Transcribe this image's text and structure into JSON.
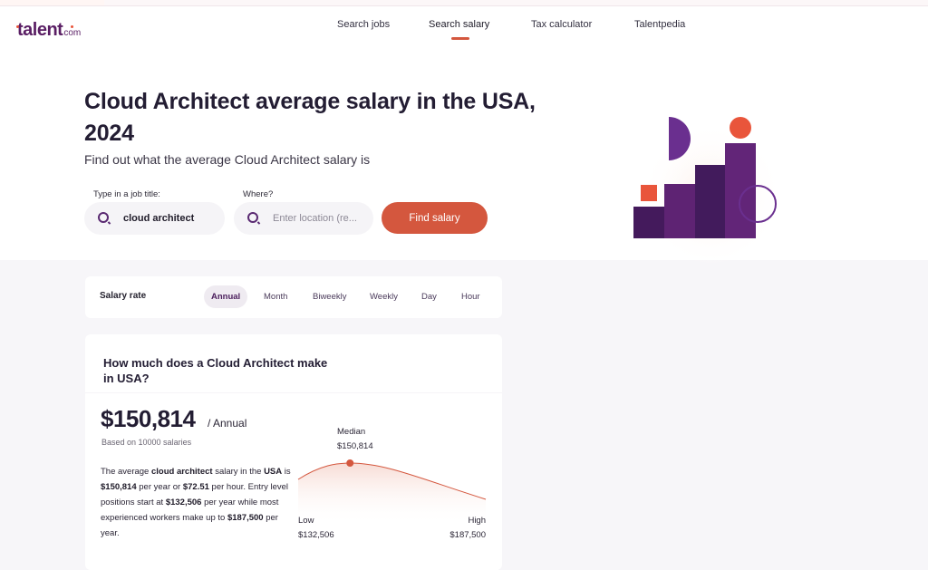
{
  "brand": {
    "name": "talent",
    "suffix": "com",
    "accent_color": "#d4573e",
    "primary_color": "#5a1e64"
  },
  "nav": {
    "items": [
      {
        "label": "Search jobs",
        "active": false
      },
      {
        "label": "Search salary",
        "active": true
      },
      {
        "label": "Tax calculator",
        "active": false
      },
      {
        "label": "Talentpedia",
        "active": false
      }
    ]
  },
  "hero": {
    "title": "Cloud Architect average salary in the USA, 2024",
    "subtitle": "Find out what the average Cloud Architect salary is"
  },
  "search": {
    "job_label": "Type in a job title:",
    "job_value": "cloud architect",
    "location_label": "Where?",
    "location_placeholder": "Enter location (re...",
    "submit_label": "Find salary"
  },
  "salary_rate": {
    "label": "Salary rate",
    "options": [
      "Annual",
      "Month",
      "Biweekly",
      "Weekly",
      "Day",
      "Hour"
    ],
    "selected": "Annual"
  },
  "summary": {
    "heading": "How much does a Cloud Architect make in USA?",
    "amount": "$150,814",
    "period": "/ Annual",
    "based_on": "Based on 10000 salaries",
    "description": {
      "p1": "The average ",
      "job": "cloud architect",
      "p2": " salary in the ",
      "country": "USA",
      "p3": " is ",
      "yearly": "$150,814",
      "p4": " per year or ",
      "hourly": "$72.51",
      "p5": " per hour. Entry level positions start at ",
      "low": "$132,506",
      "p6": " per year while most experienced workers make up to ",
      "high": "$187,500",
      "p7": " per year."
    }
  },
  "distribution": {
    "median_label": "Median",
    "median_value": "$150,814",
    "low_label": "Low",
    "low_value": "$132,506",
    "high_label": "High",
    "high_value": "$187,500",
    "median_position_fraction": 0.28,
    "curve_color": "#d4573e"
  }
}
